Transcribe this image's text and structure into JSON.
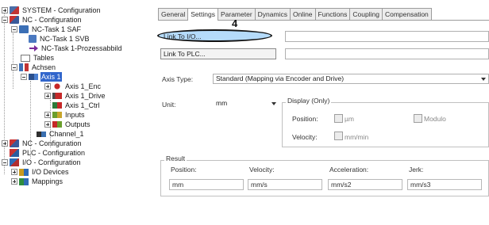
{
  "tree": {
    "items": [
      {
        "label": "SYSTEM - Configuration",
        "icon": "system-config-icon"
      },
      {
        "label": "NC - Configuration",
        "icon": "nc-config-icon"
      },
      {
        "label": "NC-Task 1 SAF",
        "icon": "task-icon"
      },
      {
        "label": "NC-Task 1 SVB",
        "icon": "task-icon"
      },
      {
        "label": "NC-Task 1-Prozessabbild",
        "icon": "process-image-icon"
      },
      {
        "label": "Tables",
        "icon": "table-icon"
      },
      {
        "label": "Achsen",
        "icon": "axes-icon"
      },
      {
        "label": "Axis 1",
        "icon": "axis-icon"
      },
      {
        "label": "Axis 1_Enc",
        "icon": "encoder-icon"
      },
      {
        "label": "Axis 1_Drive",
        "icon": "drive-icon"
      },
      {
        "label": "Axis 1_Ctrl",
        "icon": "controller-icon"
      },
      {
        "label": "Inputs",
        "icon": "inputs-icon"
      },
      {
        "label": "Outputs",
        "icon": "outputs-icon"
      },
      {
        "label": "Channel_1",
        "icon": "channel-icon"
      },
      {
        "label": "NC - Configuration",
        "icon": "nc-config-icon"
      },
      {
        "label": "PLC - Configuration",
        "icon": "plc-config-icon"
      },
      {
        "label": "I/O - Configuration",
        "icon": "io-config-icon"
      },
      {
        "label": "I/O Devices",
        "icon": "io-devices-icon"
      },
      {
        "label": "Mappings",
        "icon": "mappings-icon"
      }
    ]
  },
  "tabs": [
    "General",
    "Settings",
    "Parameter",
    "Dynamics",
    "Online",
    "Functions",
    "Coupling",
    "Compensation"
  ],
  "active_tab": "Settings",
  "annotation": {
    "step": "4"
  },
  "settings": {
    "link_io_label": "Link To I/O...",
    "link_plc_label": "Link To PLC...",
    "axis_type_label": "Axis Type:",
    "axis_type_value": "Standard (Mapping via Encoder and Drive)",
    "unit_label": "Unit:",
    "unit_value": "mm",
    "display_title": "Display (Only)",
    "position_label": "Position:",
    "um_label": "µm",
    "modulo_label": "Modulo",
    "velocity_label": "Velocity:",
    "mm_min_label": "mm/min"
  },
  "result": {
    "title": "Result",
    "headers": [
      "Position:",
      "Velocity:",
      "Acceleration:",
      "Jerk:"
    ],
    "values": [
      "mm",
      "mm/s",
      "mm/s2",
      "mm/s3"
    ]
  },
  "colors": {
    "selection": "#3266cc",
    "highlight": "#78bef5"
  }
}
